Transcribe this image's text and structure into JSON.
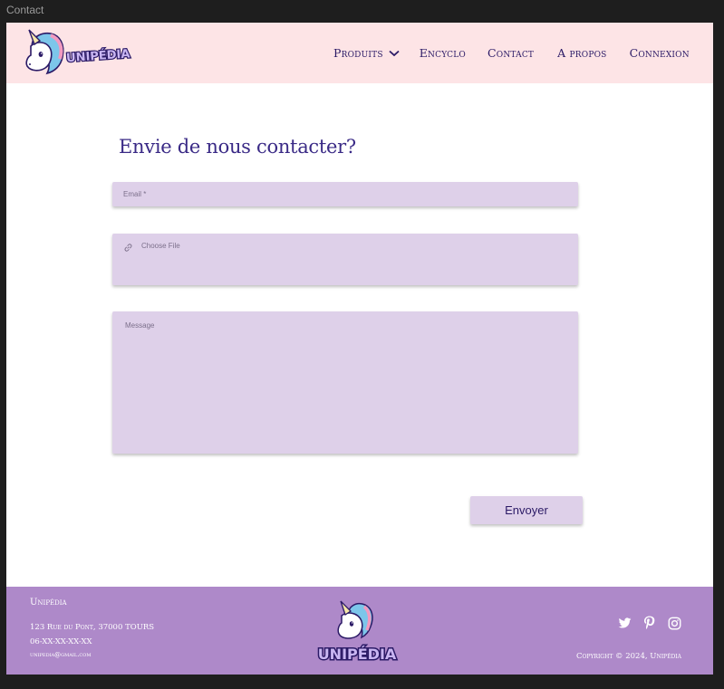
{
  "window": {
    "title": "Contact"
  },
  "header": {
    "logo_text": "UNIPÉDIA",
    "nav": [
      {
        "label": "Produits"
      },
      {
        "label": "Encyclo"
      },
      {
        "label": "Contact"
      },
      {
        "label": "A propos"
      },
      {
        "label": "Connexion"
      }
    ]
  },
  "form": {
    "title": "Envie de nous contacter?",
    "email_placeholder": "Email *",
    "file_placeholder": "Choose File",
    "message_placeholder": "Message",
    "submit_label": "Envoyer"
  },
  "footer": {
    "brand": "Unipédia",
    "address": "123 Rue du Pont, 37000 TOURS",
    "phone": "06-XX-XX-XX-XX",
    "email": "unipedia@gmail.com",
    "logo_text": "UNIPÉDIA",
    "copyright": "Copyright © 2024, Unipédia",
    "social_icons": [
      "twitter-icon",
      "pinterest-icon",
      "instagram-icon"
    ]
  },
  "colors": {
    "header_bg": "#fde4e6",
    "footer_bg": "#ae89c9",
    "field_bg": "#ded0e9",
    "text_primary": "#2b1a66"
  }
}
